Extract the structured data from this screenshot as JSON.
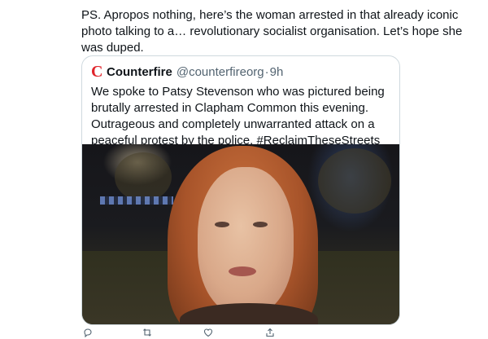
{
  "tweet": {
    "text": "PS. Apropos nothing, here’s the woman arrested in that already iconic photo talking to a… revolutionary socialist organisation. Let’s hope she was duped."
  },
  "quote": {
    "logo_letter": "C",
    "author_name": "Counterfire",
    "author_handle": "@counterfireorg",
    "separator": "·",
    "time": "9h",
    "text": "We spoke to Patsy Stevenson who was pictured being brutally arrested in Clapham Common this evening. Outrageous and completely unwarranted attack on a peaceful protest by the police. #ReclaimTheseStreets #EndViolenceAgainstWomen"
  },
  "actions": [
    {
      "icon": "reply-icon"
    },
    {
      "icon": "retweet-icon"
    },
    {
      "icon": "like-icon"
    },
    {
      "icon": "share-icon"
    }
  ],
  "colors": {
    "text": "#0f1419",
    "secondary": "#536471",
    "border": "#cfd9de",
    "brand_red": "#e0242b"
  }
}
